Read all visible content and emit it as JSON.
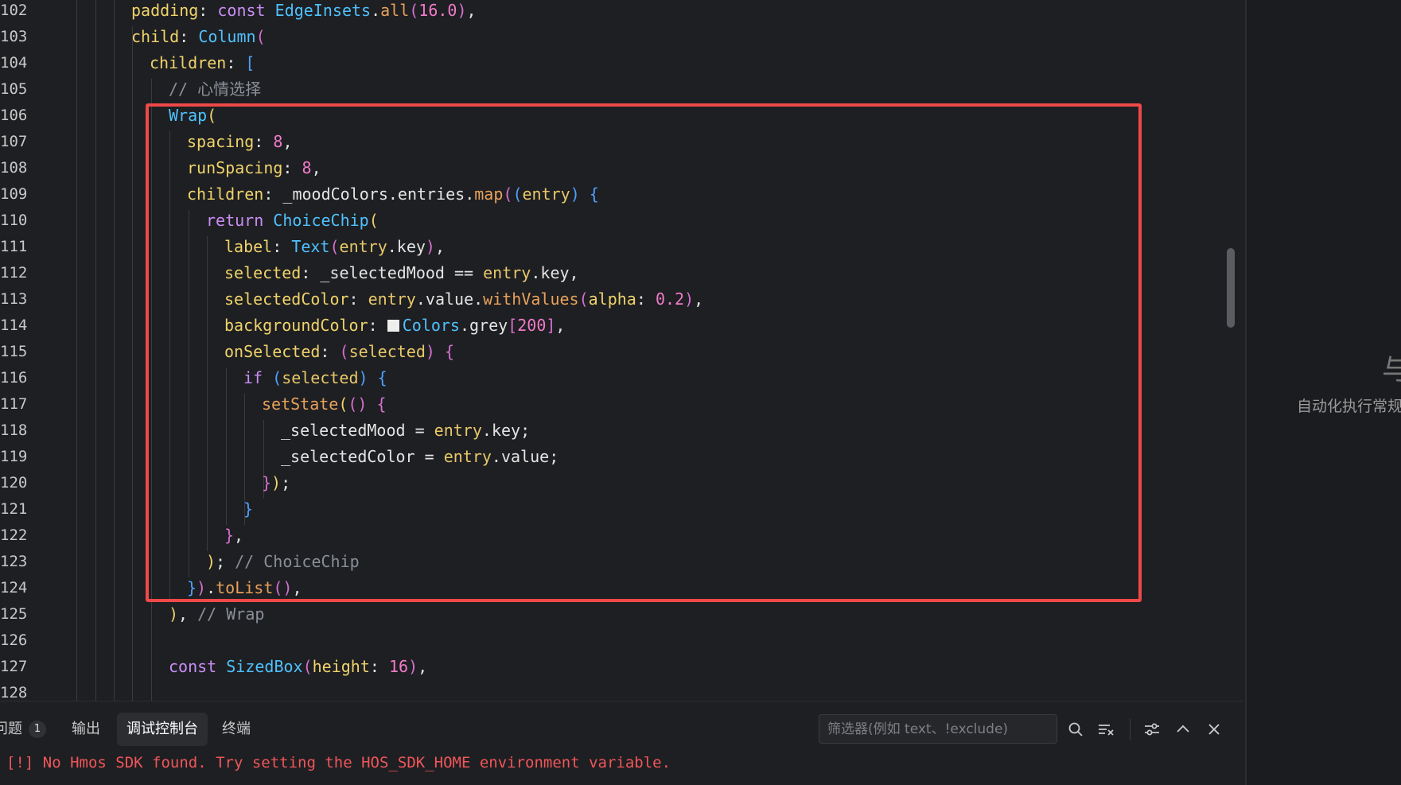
{
  "editor": {
    "line_numbers": [
      "102",
      "103",
      "104",
      "105",
      "106",
      "107",
      "108",
      "109",
      "110",
      "111",
      "112",
      "113",
      "114",
      "115",
      "116",
      "117",
      "118",
      "119",
      "120",
      "121",
      "122",
      "123",
      "124",
      "125",
      "126",
      "127",
      "128"
    ],
    "lines": [
      {
        "text": "padding: const EdgeInsets.all(16.0),"
      },
      {
        "text": "child: Column("
      },
      {
        "text": "children: ["
      },
      {
        "text": "// 心情选择"
      },
      {
        "text": "Wrap("
      },
      {
        "text": "spacing: 8,"
      },
      {
        "text": "runSpacing: 8,"
      },
      {
        "text": "children: _moodColors.entries.map((entry) {"
      },
      {
        "text": "return ChoiceChip("
      },
      {
        "text": "label: Text(entry.key),"
      },
      {
        "text": "selected: _selectedMood == entry.key,"
      },
      {
        "text": "selectedColor: entry.value.withValues(alpha: 0.2),"
      },
      {
        "text": "backgroundColor: Colors.grey[200],"
      },
      {
        "text": "onSelected: (selected) {"
      },
      {
        "text": "if (selected) {"
      },
      {
        "text": "setState(() {"
      },
      {
        "text": "_selectedMood = entry.key;"
      },
      {
        "text": "_selectedColor = entry.value;"
      },
      {
        "text": "});"
      },
      {
        "text": "}"
      },
      {
        "text": "},"
      },
      {
        "text": "); // ChoiceChip"
      },
      {
        "text": "}).toList(),"
      },
      {
        "text": "), // Wrap"
      },
      {
        "text": ""
      },
      {
        "text": "const SizedBox(height: 16),"
      },
      {
        "text": ""
      }
    ],
    "highlight_color": "#f04848"
  },
  "right_panel": {
    "glyph": "与",
    "text": "自动化执行常规"
  },
  "bottom_panel": {
    "tabs": [
      {
        "label": "问题",
        "badge": "1"
      },
      {
        "label": "输出"
      },
      {
        "label": "调试控制台",
        "active": true
      },
      {
        "label": "终端"
      }
    ],
    "filter_placeholder": "筛选器(例如 text、!exclude)",
    "icons": [
      "search-icon",
      "clear-filter-icon",
      "settings-icon",
      "chevron-up-icon",
      "close-icon"
    ],
    "console_message": "[!] No Hmos SDK found. Try setting the HOS_SDK_HOME environment variable.",
    "error_color": "#f0565a"
  }
}
